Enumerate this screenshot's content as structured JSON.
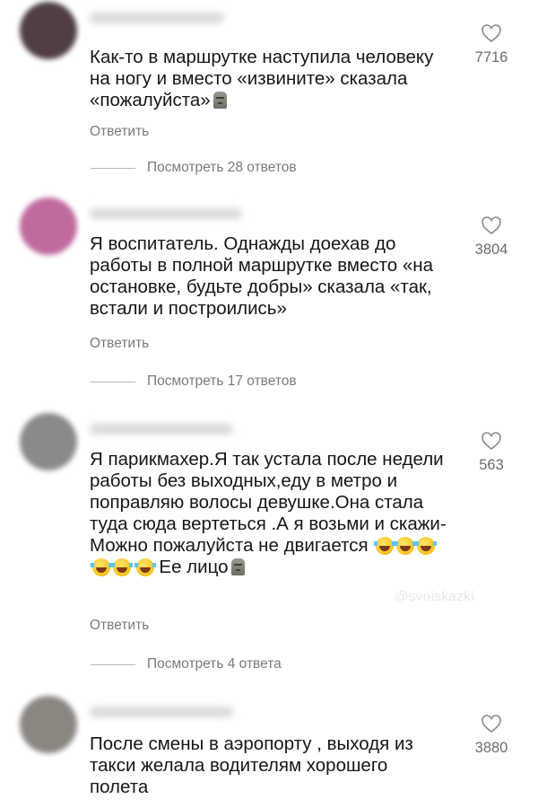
{
  "comments": [
    {
      "text": "Как-то в маршрутке наступила человеку на ногу и вместо «извините» сказала «пожалуйста»",
      "emoji": "moai",
      "likes": "7716",
      "reply_label": "Ответить",
      "view_replies": "Посмотреть 28 ответов"
    },
    {
      "text": "Я воспитатель. Однажды доехав до работы в полной маршрутке вместо «на остановке, будьте добры» сказала «так, встали и построились»",
      "likes": "3804",
      "reply_label": "Ответить",
      "view_replies": "Посмотреть 17 ответов"
    },
    {
      "text": "Я парикмахер.Я так устала после недели работы без выходных,еду в метро и поправляю волосы девушке.Она стала туда сюда вертеться .А я возьми и скажи-Можно пожалуйста не двигается",
      "text_tail": "Ее лицо",
      "emoji": "laugh x6, moai",
      "likes": "563",
      "reply_label": "Ответить",
      "view_replies": "Посмотреть 4 ответа"
    },
    {
      "text": "После смены в аэропорту , выходя из такси желала водителям хорошего полета",
      "likes": "3880"
    }
  ],
  "watermark": "@svoiskazki",
  "icons": {
    "like": "heart-outline-icon"
  },
  "colors": {
    "background": "#ffffff",
    "text": "#161616",
    "secondary": "#7a7a7a"
  }
}
